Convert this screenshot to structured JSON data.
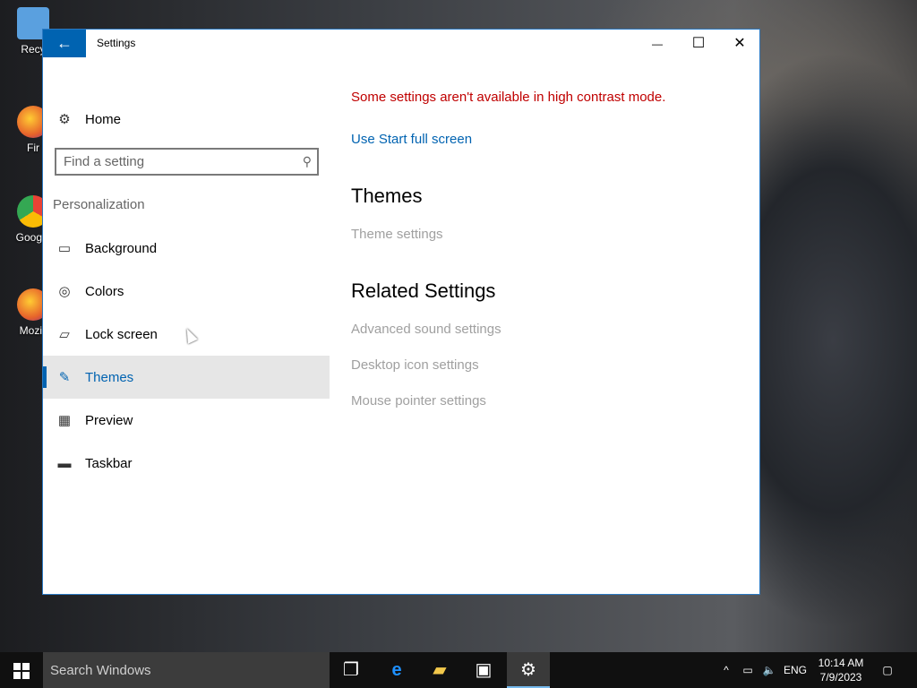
{
  "desktop": {
    "icons": [
      {
        "label": "Recy",
        "icon": "recycle-bin-icon",
        "color": "#3b8fd6"
      },
      {
        "label": "Fir",
        "icon": "firefox-icon",
        "color": "#e6622b"
      },
      {
        "label": "Google",
        "icon": "chrome-icon",
        "color": "#34a853"
      },
      {
        "label": "Mozill",
        "icon": "firefox-icon",
        "color": "#e6622b"
      }
    ]
  },
  "window": {
    "title": "Settings",
    "accent": "#0063b1",
    "back_glyph": "←",
    "min_glyph": "—",
    "max_glyph": "☐",
    "close_glyph": "✕"
  },
  "nav": {
    "home_label": "Home",
    "search_placeholder": "Find a setting",
    "section_label": "Personalization",
    "items": [
      {
        "label": "Background",
        "icon": "picture-icon"
      },
      {
        "label": "Colors",
        "icon": "palette-icon"
      },
      {
        "label": "Lock screen",
        "icon": "lock-screen-icon"
      },
      {
        "label": "Themes",
        "icon": "themes-icon",
        "active": true
      },
      {
        "label": "Preview",
        "icon": "preview-icon"
      },
      {
        "label": "Taskbar",
        "icon": "taskbar-icon"
      }
    ]
  },
  "content": {
    "warning": "Some settings aren't available in high contrast mode.",
    "start_link": "Use Start full screen",
    "themes_heading": "Themes",
    "theme_settings": "Theme settings",
    "related_heading": "Related Settings",
    "related_links": [
      "Advanced sound settings",
      "Desktop icon settings",
      "Mouse pointer settings"
    ],
    "warning_color": "#c00000",
    "disabled_color": "#a0a0a0"
  },
  "taskbar": {
    "search_placeholder": "Search Windows",
    "tray_lang": "ENG",
    "time": "10:14 AM",
    "date": "7/9/2023"
  }
}
